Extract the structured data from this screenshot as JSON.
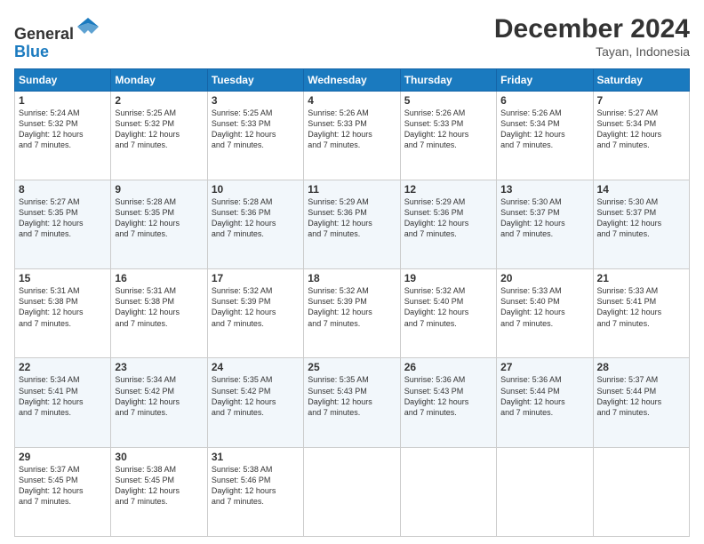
{
  "logo": {
    "line1": "General",
    "line2": "Blue"
  },
  "title": "December 2024",
  "location": "Tayan, Indonesia",
  "weekdays": [
    "Sunday",
    "Monday",
    "Tuesday",
    "Wednesday",
    "Thursday",
    "Friday",
    "Saturday"
  ],
  "weeks": [
    [
      {
        "day": "1",
        "sunrise": "5:24 AM",
        "sunset": "5:32 PM",
        "daylight": "12 hours and 7 minutes."
      },
      {
        "day": "2",
        "sunrise": "5:25 AM",
        "sunset": "5:32 PM",
        "daylight": "12 hours and 7 minutes."
      },
      {
        "day": "3",
        "sunrise": "5:25 AM",
        "sunset": "5:33 PM",
        "daylight": "12 hours and 7 minutes."
      },
      {
        "day": "4",
        "sunrise": "5:26 AM",
        "sunset": "5:33 PM",
        "daylight": "12 hours and 7 minutes."
      },
      {
        "day": "5",
        "sunrise": "5:26 AM",
        "sunset": "5:33 PM",
        "daylight": "12 hours and 7 minutes."
      },
      {
        "day": "6",
        "sunrise": "5:26 AM",
        "sunset": "5:34 PM",
        "daylight": "12 hours and 7 minutes."
      },
      {
        "day": "7",
        "sunrise": "5:27 AM",
        "sunset": "5:34 PM",
        "daylight": "12 hours and 7 minutes."
      }
    ],
    [
      {
        "day": "8",
        "sunrise": "5:27 AM",
        "sunset": "5:35 PM",
        "daylight": "12 hours and 7 minutes."
      },
      {
        "day": "9",
        "sunrise": "5:28 AM",
        "sunset": "5:35 PM",
        "daylight": "12 hours and 7 minutes."
      },
      {
        "day": "10",
        "sunrise": "5:28 AM",
        "sunset": "5:36 PM",
        "daylight": "12 hours and 7 minutes."
      },
      {
        "day": "11",
        "sunrise": "5:29 AM",
        "sunset": "5:36 PM",
        "daylight": "12 hours and 7 minutes."
      },
      {
        "day": "12",
        "sunrise": "5:29 AM",
        "sunset": "5:36 PM",
        "daylight": "12 hours and 7 minutes."
      },
      {
        "day": "13",
        "sunrise": "5:30 AM",
        "sunset": "5:37 PM",
        "daylight": "12 hours and 7 minutes."
      },
      {
        "day": "14",
        "sunrise": "5:30 AM",
        "sunset": "5:37 PM",
        "daylight": "12 hours and 7 minutes."
      }
    ],
    [
      {
        "day": "15",
        "sunrise": "5:31 AM",
        "sunset": "5:38 PM",
        "daylight": "12 hours and 7 minutes."
      },
      {
        "day": "16",
        "sunrise": "5:31 AM",
        "sunset": "5:38 PM",
        "daylight": "12 hours and 7 minutes."
      },
      {
        "day": "17",
        "sunrise": "5:32 AM",
        "sunset": "5:39 PM",
        "daylight": "12 hours and 7 minutes."
      },
      {
        "day": "18",
        "sunrise": "5:32 AM",
        "sunset": "5:39 PM",
        "daylight": "12 hours and 7 minutes."
      },
      {
        "day": "19",
        "sunrise": "5:32 AM",
        "sunset": "5:40 PM",
        "daylight": "12 hours and 7 minutes."
      },
      {
        "day": "20",
        "sunrise": "5:33 AM",
        "sunset": "5:40 PM",
        "daylight": "12 hours and 7 minutes."
      },
      {
        "day": "21",
        "sunrise": "5:33 AM",
        "sunset": "5:41 PM",
        "daylight": "12 hours and 7 minutes."
      }
    ],
    [
      {
        "day": "22",
        "sunrise": "5:34 AM",
        "sunset": "5:41 PM",
        "daylight": "12 hours and 7 minutes."
      },
      {
        "day": "23",
        "sunrise": "5:34 AM",
        "sunset": "5:42 PM",
        "daylight": "12 hours and 7 minutes."
      },
      {
        "day": "24",
        "sunrise": "5:35 AM",
        "sunset": "5:42 PM",
        "daylight": "12 hours and 7 minutes."
      },
      {
        "day": "25",
        "sunrise": "5:35 AM",
        "sunset": "5:43 PM",
        "daylight": "12 hours and 7 minutes."
      },
      {
        "day": "26",
        "sunrise": "5:36 AM",
        "sunset": "5:43 PM",
        "daylight": "12 hours and 7 minutes."
      },
      {
        "day": "27",
        "sunrise": "5:36 AM",
        "sunset": "5:44 PM",
        "daylight": "12 hours and 7 minutes."
      },
      {
        "day": "28",
        "sunrise": "5:37 AM",
        "sunset": "5:44 PM",
        "daylight": "12 hours and 7 minutes."
      }
    ],
    [
      {
        "day": "29",
        "sunrise": "5:37 AM",
        "sunset": "5:45 PM",
        "daylight": "12 hours and 7 minutes."
      },
      {
        "day": "30",
        "sunrise": "5:38 AM",
        "sunset": "5:45 PM",
        "daylight": "12 hours and 7 minutes."
      },
      {
        "day": "31",
        "sunrise": "5:38 AM",
        "sunset": "5:46 PM",
        "daylight": "12 hours and 7 minutes."
      },
      null,
      null,
      null,
      null
    ]
  ],
  "labels": {
    "sunrise": "Sunrise: ",
    "sunset": "Sunset: ",
    "daylight": "Daylight: "
  }
}
